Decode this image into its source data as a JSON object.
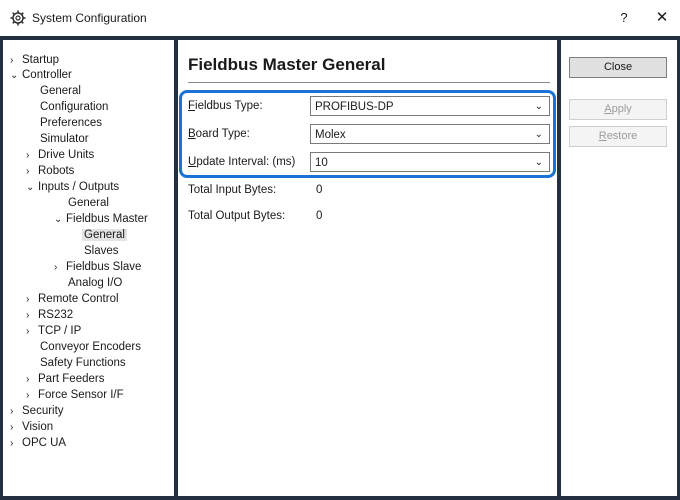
{
  "window": {
    "title": "System Configuration",
    "help_label": "?",
    "close_label": "✕"
  },
  "tree": {
    "items": [
      {
        "label": "Startup",
        "chevron": "›"
      },
      {
        "label": "Controller",
        "chevron": "⌄"
      },
      {
        "label": "General",
        "chevron": ""
      },
      {
        "label": "Configuration",
        "chevron": ""
      },
      {
        "label": "Preferences",
        "chevron": ""
      },
      {
        "label": "Simulator",
        "chevron": ""
      },
      {
        "label": "Drive Units",
        "chevron": "›"
      },
      {
        "label": "Robots",
        "chevron": "›"
      },
      {
        "label": "Inputs / Outputs",
        "chevron": "⌄"
      },
      {
        "label": "General",
        "chevron": ""
      },
      {
        "label": "Fieldbus Master",
        "chevron": "⌄"
      },
      {
        "label": "General",
        "chevron": ""
      },
      {
        "label": "Slaves",
        "chevron": ""
      },
      {
        "label": "Fieldbus Slave",
        "chevron": "›"
      },
      {
        "label": "Analog I/O",
        "chevron": ""
      },
      {
        "label": "Remote Control",
        "chevron": "›"
      },
      {
        "label": "RS232",
        "chevron": "›"
      },
      {
        "label": "TCP / IP",
        "chevron": "›"
      },
      {
        "label": "Conveyor Encoders",
        "chevron": ""
      },
      {
        "label": "Safety Functions",
        "chevron": ""
      },
      {
        "label": "Part Feeders",
        "chevron": "›"
      },
      {
        "label": "Force Sensor I/F",
        "chevron": "›"
      },
      {
        "label": "Security",
        "chevron": "›"
      },
      {
        "label": "Vision",
        "chevron": "›"
      },
      {
        "label": "OPC UA",
        "chevron": "›"
      }
    ]
  },
  "main": {
    "title": "Fieldbus Master General",
    "fieldbus_type": {
      "label_accel": "F",
      "label_rest": "ieldbus Type:",
      "value": "PROFIBUS-DP"
    },
    "board_type": {
      "label_accel": "B",
      "label_rest": "oard Type:",
      "value": "Molex"
    },
    "update_interval": {
      "label_accel": "U",
      "label_rest": "pdate Interval: (ms)",
      "value": "10"
    },
    "total_input_bytes": {
      "label": "Total Input Bytes:",
      "value": "0"
    },
    "total_output_bytes": {
      "label": "Total Output Bytes:",
      "value": "0"
    },
    "dropdown_arrow": "⌄"
  },
  "buttons": {
    "close": "Close",
    "apply_accel": "A",
    "apply_rest": "pply",
    "restore_accel": "R",
    "restore_rest": "estore"
  },
  "colors": {
    "frame": "#223041",
    "highlight": "#1a72d6"
  }
}
